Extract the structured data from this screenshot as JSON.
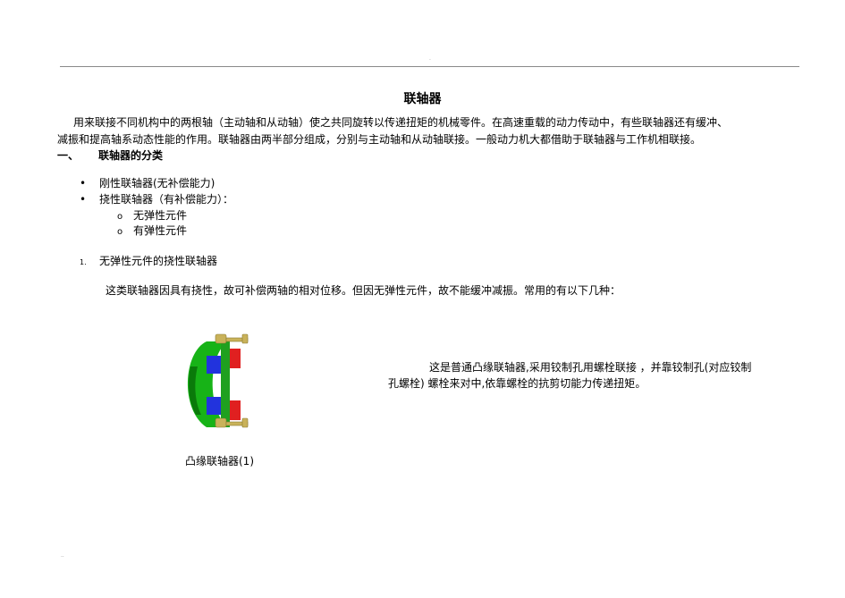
{
  "header": {
    "dot_top": ".",
    "dot_bottom": ".."
  },
  "title": "联轴器",
  "intro": {
    "line1": "用来联接不同机构中的两根轴（主动轴和从动轴）使之共同旋转以传递扭矩的机械零件。在高速重载的动力传动中，有些联轴器还有缓冲、",
    "line2": "减振和提高轴系动态性能的作用。联轴器由两半部分组成，分别与主动轴和从动轴联接。一般动力机大都借助于联轴器与工作机相联接。"
  },
  "section1": {
    "marker": "一、",
    "heading": "联轴器的分类"
  },
  "classes": [
    {
      "marker": "•",
      "label": "刚性联轴器(无补偿能力)"
    },
    {
      "marker": "•",
      "label": "挠性联轴器（有补偿能力）："
    }
  ],
  "subclasses": [
    {
      "marker": "o",
      "label": "无弹性元件"
    },
    {
      "marker": "o",
      "label": "有弹性元件"
    }
  ],
  "item1": {
    "marker": "1.",
    "label": "无弹性元件的挠性联轴器"
  },
  "item1_text": "这类联轴器因具有挠性，故可补偿两轴的相对位移。但因无弹性元件，故不能缓冲减振。常用的有以下几种：",
  "figure": {
    "caption": "凸缘联轴器(1)",
    "desc_line1": "这是普通凸缘联轴器,采用铰制孔用螺栓联接 ，并靠铰制孔(对应铰制",
    "desc_line2": "孔螺栓) 螺栓来对中,依靠螺栓的抗剪切能力传递扭矩。",
    "colors": {
      "hub": "#17b317",
      "hub_dark": "#0a7a0a",
      "flange_blue": "#2233dd",
      "flange_red": "#e02020",
      "bolt": "#c9b25a"
    }
  }
}
